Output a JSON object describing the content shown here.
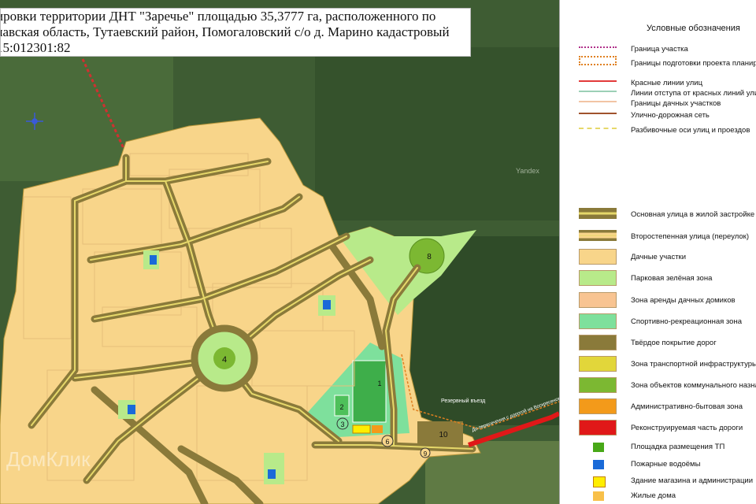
{
  "title": {
    "line1": "ировки территории ДНТ \"Заречье\" площадью 35,3777 га,  расположенного по",
    "line2": "лавская область, Тутаевский район, Помогаловский с/о д. Марино    кадастровый",
    "line3": "15:012301:82"
  },
  "map_labels": {
    "circle_4": "4",
    "circle_8": "8",
    "circle_6": "6",
    "circle_9": "9",
    "box_10": "10",
    "sport_1": "1",
    "sport_2": "2",
    "sport_3": "3",
    "reserve_entry": "Резервный въезд",
    "road_sign": "До пересечения с дорогой на Воскресенское",
    "yandex": "Yandex",
    "watermark": "ДомКлик"
  },
  "legend": {
    "title": "Условные обозначения",
    "line_items": [
      {
        "label": "Граница участка",
        "style": "dotted",
        "color": "#b0308a"
      },
      {
        "label": "Границы подготовки проекта планир",
        "style": "box",
        "color": "#e08020"
      },
      {
        "label": "Красные линии улиц",
        "style": "solid",
        "color": "#e23a3a"
      },
      {
        "label": "Линии отступа от красных линий ули",
        "style": "solid",
        "color": "#9cd0b6"
      },
      {
        "label": "Границы дачных участков",
        "style": "solid",
        "color": "#f2c4a4"
      },
      {
        "label": "Улично-дорожная сеть",
        "style": "solid",
        "color": "#a0522d"
      },
      {
        "label": "Разбивочные оси улиц и проездов",
        "style": "dashed",
        "color": "#e6d86a"
      }
    ],
    "fill_items": [
      {
        "label": "Основная улица в жилой застройке",
        "style": "road-main"
      },
      {
        "label": "Второстепенная улица (переулок)",
        "style": "road-minor"
      },
      {
        "label": "Дачные участки",
        "color": "#f8d58a"
      },
      {
        "label": "Парковая зелёная зона",
        "color": "#b8ea8a"
      },
      {
        "label": "Зона аренды дачных домиков",
        "color": "#f8c492"
      },
      {
        "label": "Спортивно-рекреационная зона",
        "color": "#7ee09c"
      },
      {
        "label": "Твёрдое покрытие дорог",
        "color": "#8a7a3a"
      },
      {
        "label": "Зона транспортной инфраструктуры",
        "color": "#e2d63a"
      },
      {
        "label": "Зона объектов коммунального назна",
        "color": "#7cb832"
      },
      {
        "label": "Административно-бытовая зона",
        "color": "#f39a1a"
      },
      {
        "label": "Реконструируемая часть дороги",
        "color": "#e01818"
      },
      {
        "label": "Площадка размещения ТП",
        "color": "#48a818",
        "small": true
      },
      {
        "label": "Пожарные водоёмы",
        "color": "#1a6ad8",
        "small": true
      },
      {
        "label": "Здание магазина и администрации",
        "color": "#ffee00",
        "small": true,
        "border": "#c08000"
      },
      {
        "label": "Жилые дома",
        "color": "#f8c04a",
        "small": true
      }
    ]
  }
}
